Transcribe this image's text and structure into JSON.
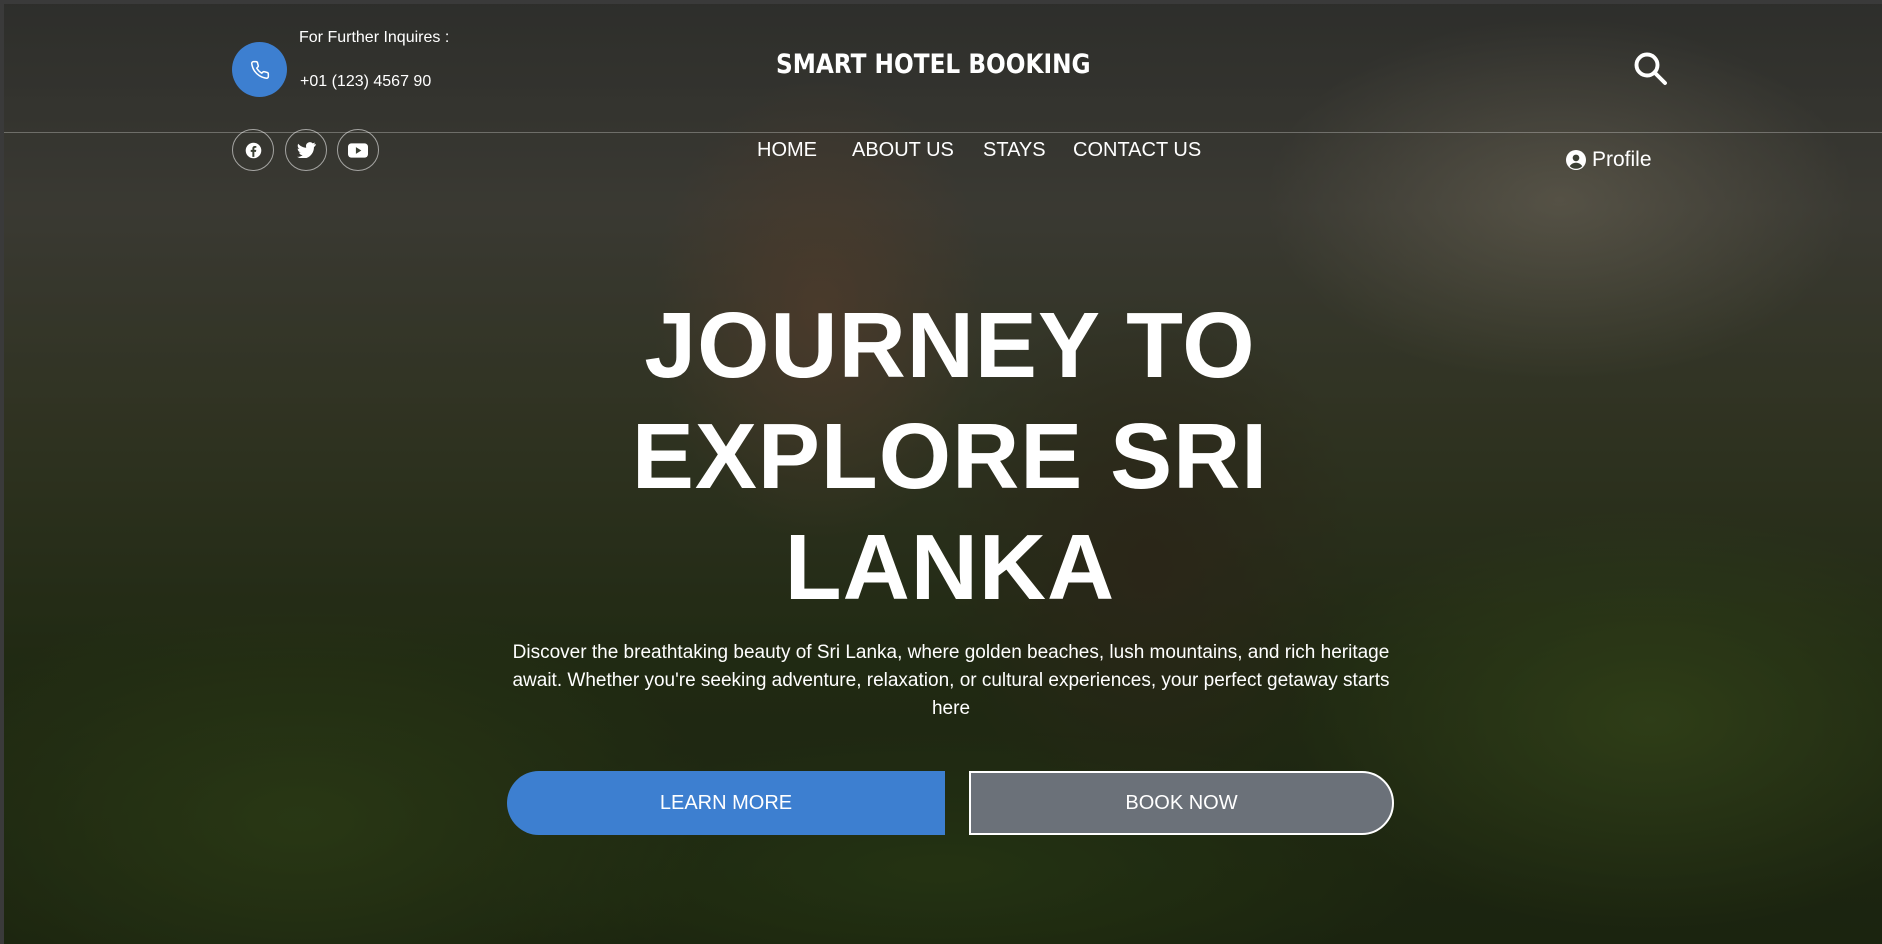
{
  "contact": {
    "inquiry_label": "For Further Inquires :",
    "phone": "+01 (123) 4567 90",
    "icon": "phone-icon"
  },
  "social": [
    {
      "name": "facebook",
      "icon": "facebook-icon"
    },
    {
      "name": "twitter",
      "icon": "twitter-icon"
    },
    {
      "name": "youtube",
      "icon": "youtube-icon"
    }
  ],
  "brand": {
    "logo_text": "SMART HOTEL BOOKING"
  },
  "nav": {
    "items": [
      "HOME",
      "ABOUT US",
      "STAYS",
      "CONTACT US"
    ]
  },
  "header": {
    "search_icon": "search-icon",
    "profile_label": "Profile"
  },
  "hero": {
    "headline_line1": "JOURNEY TO",
    "headline_line2": "EXPLORE SRI",
    "headline_line3": "LANKA",
    "description_line1": "Discover the breathtaking beauty of Sri Lanka, where golden beaches, lush mountains, and rich heritage",
    "description_line2": "await. Whether you're seeking adventure, relaxation, or cultural experiences, your perfect getaway starts",
    "description_line3": "here",
    "learn_more_label": "LEARN MORE",
    "book_now_label": "BOOK NOW"
  },
  "colors": {
    "accent": "#3d7fd0",
    "secondary_button": "#6b7179",
    "text": "#ffffff"
  }
}
